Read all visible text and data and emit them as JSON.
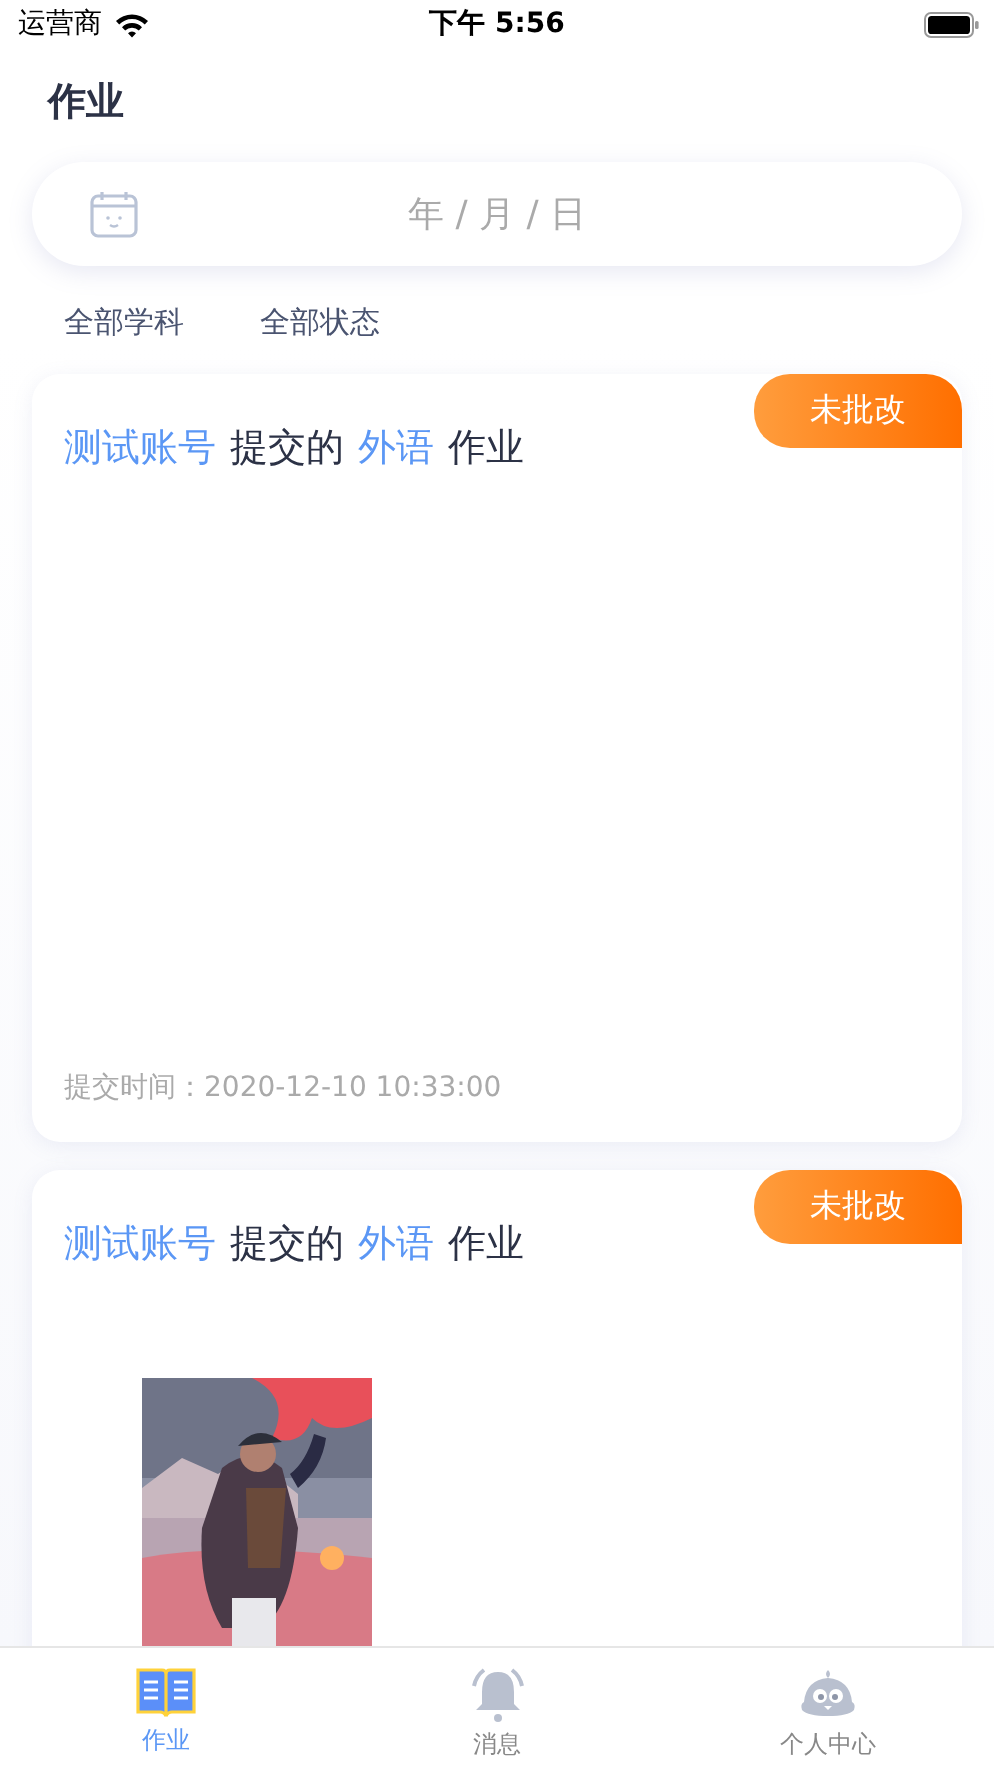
{
  "status_bar": {
    "carrier": "运营商",
    "time": "下午 5:56"
  },
  "title": "作业",
  "date_field": {
    "placeholder": "年 / 月 / 日"
  },
  "filters": [
    {
      "label": "全部学科"
    },
    {
      "label": "全部状态"
    }
  ],
  "cards": [
    {
      "status": "未批改",
      "title_parts": [
        {
          "text": "测试账号",
          "highlight": true
        },
        {
          "text": "提交的",
          "highlight": false
        },
        {
          "text": "外语",
          "highlight": true
        },
        {
          "text": "作业",
          "highlight": false
        }
      ],
      "submitted": "提交时间：2020-12-10 10:33:00"
    },
    {
      "status": "未批改",
      "title_parts": [
        {
          "text": "测试账号",
          "highlight": true
        },
        {
          "text": "提交的",
          "highlight": false
        },
        {
          "text": "外语",
          "highlight": true
        },
        {
          "text": "作业",
          "highlight": false
        }
      ]
    }
  ],
  "tabs": [
    {
      "label": "作业",
      "selected": true
    },
    {
      "label": "消息",
      "selected": false
    },
    {
      "label": "个人中心",
      "selected": false
    }
  ]
}
